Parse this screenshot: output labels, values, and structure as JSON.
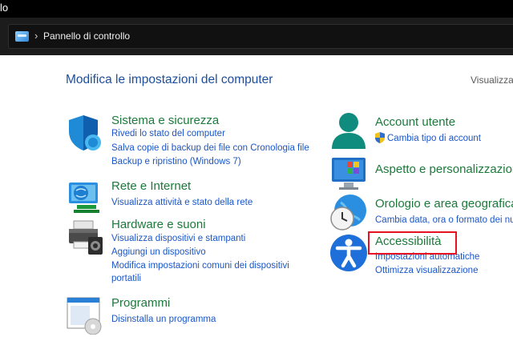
{
  "window": {
    "title": "lo"
  },
  "address_bar": {
    "breadcrumb": "Pannello di controllo"
  },
  "header": {
    "title": "Modifica le impostazioni del computer",
    "view_by": "Visualizza"
  },
  "left_categories": [
    {
      "title": "Sistema e sicurezza",
      "links": [
        "Rivedi lo stato del computer",
        "Salva copie di backup dei file con Cronologia file",
        "Backup e ripristino (Windows 7)"
      ]
    },
    {
      "title": "Rete e Internet",
      "links": [
        "Visualizza attività e stato della rete"
      ]
    },
    {
      "title": "Hardware e suoni",
      "links": [
        "Visualizza dispositivi e stampanti",
        "Aggiungi un dispositivo",
        "Modifica impostazioni comuni dei dispositivi",
        "portatili"
      ]
    },
    {
      "title": "Programmi",
      "links": [
        "Disinstalla un programma"
      ]
    }
  ],
  "right_categories": [
    {
      "title": "Account utente",
      "links": [
        "Cambia tipo di account"
      ]
    },
    {
      "title": "Aspetto e personalizzazione",
      "links": []
    },
    {
      "title": "Orologio e area geografica",
      "links": [
        "Cambia data, ora o formato dei numeri"
      ]
    },
    {
      "title": "Accessibilità",
      "links": [
        "Impostazioni automatiche",
        "Ottimizza visualizzazione"
      ]
    }
  ],
  "colors": {
    "category_title": "#1b7a3a",
    "link": "#1a56c8",
    "header": "#1e4e9b",
    "highlight_box": "#e81123"
  },
  "icons": [
    "control-panel-icon",
    "shield-icon",
    "network-icon",
    "printer-icon",
    "programs-icon",
    "user-icon",
    "uac-shield-icon",
    "appearance-icon",
    "clock-globe-icon",
    "accessibility-icon"
  ]
}
